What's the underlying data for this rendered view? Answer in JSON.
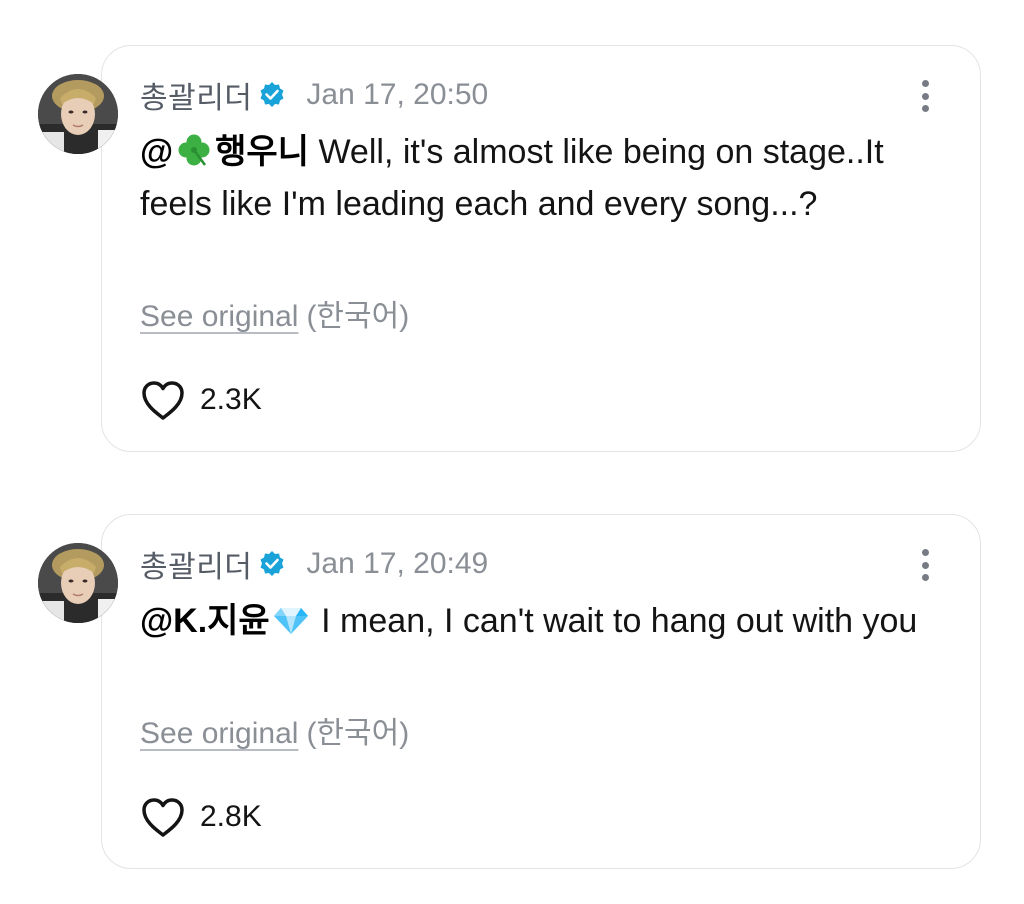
{
  "posts": [
    {
      "username": "총괄리더",
      "timestamp": "Jan 17, 20:50",
      "mention": "@🍀행우니",
      "mention_handle_text": "행우니",
      "mention_prefix": "@",
      "mention_emoji": "four-leaf-clover-icon",
      "text": " Well, it's almost like being on stage..It feels like I'm leading each and every song...?",
      "see_original": "See original",
      "language": "(한국어)",
      "likes": "2.3K"
    },
    {
      "username": "총괄리더",
      "timestamp": "Jan 17, 20:49",
      "mention": "@K.지윤💎",
      "mention_handle_text": "K.지윤",
      "mention_prefix": "@",
      "mention_emoji": "gem-icon",
      "text": " I mean, I can't wait to hang out with you",
      "see_original": "See original",
      "language": "(한국어)",
      "likes": "2.8K"
    }
  ],
  "colors": {
    "verified_badge": "#1aa3d9",
    "card_border": "#e4e4e4",
    "muted_text": "#8a8f96",
    "clover": "#3cb043",
    "gem": "#4fc3f7"
  }
}
